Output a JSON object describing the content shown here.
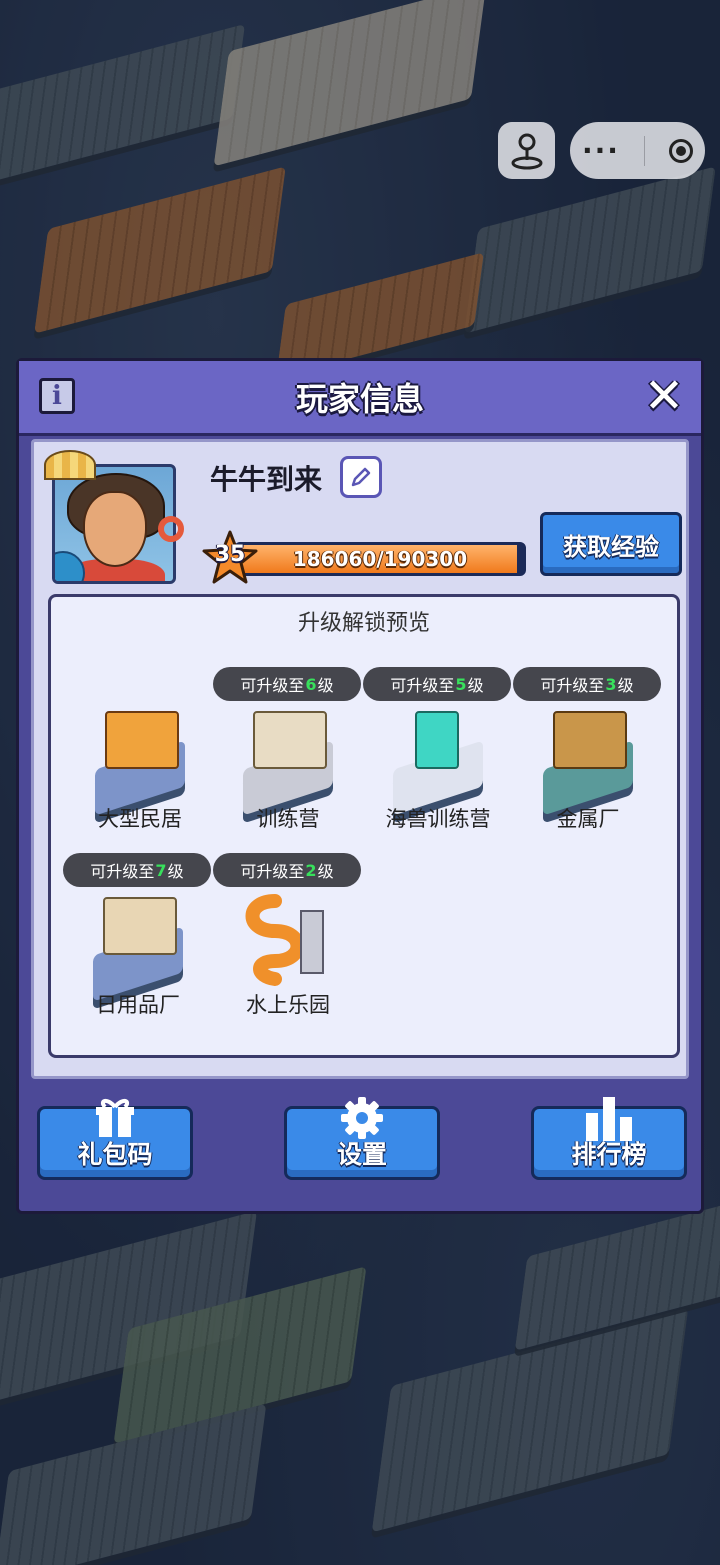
{
  "modal": {
    "title": "玩家信息",
    "info_icon": "i",
    "close_icon": "✕"
  },
  "player": {
    "name": "牛牛到来",
    "level": "35",
    "exp_text": "186060/190300",
    "exp_current": 186060,
    "exp_max": 190300,
    "get_exp_label": "获取经验"
  },
  "preview": {
    "title": "升级解锁预览",
    "tag_prefix": "可升级至",
    "tag_suffix": "级",
    "buildings": [
      {
        "name": "大型民居",
        "tag_level": null,
        "icon": "house-icon"
      },
      {
        "name": "训练营",
        "tag_level": "6",
        "icon": "training-camp-icon"
      },
      {
        "name": "海兽训练营",
        "tag_level": "5",
        "icon": "sea-beast-camp-icon"
      },
      {
        "name": "金属厂",
        "tag_level": "3",
        "icon": "metal-factory-icon"
      },
      {
        "name": "日用品厂",
        "tag_level": "7",
        "icon": "daily-goods-factory-icon"
      },
      {
        "name": "水上乐园",
        "tag_level": "2",
        "icon": "water-park-icon"
      }
    ]
  },
  "buttons": {
    "gift_code": "礼包码",
    "settings": "设置",
    "leaderboard": "排行榜"
  },
  "capsule": {
    "more": "···"
  },
  "colors": {
    "modal_bg": "#4c4997",
    "header_bg": "#6b66c5",
    "button_blue": "#3a8ae8",
    "exp_orange": "#f07a1c",
    "level_green": "#38e05c"
  }
}
